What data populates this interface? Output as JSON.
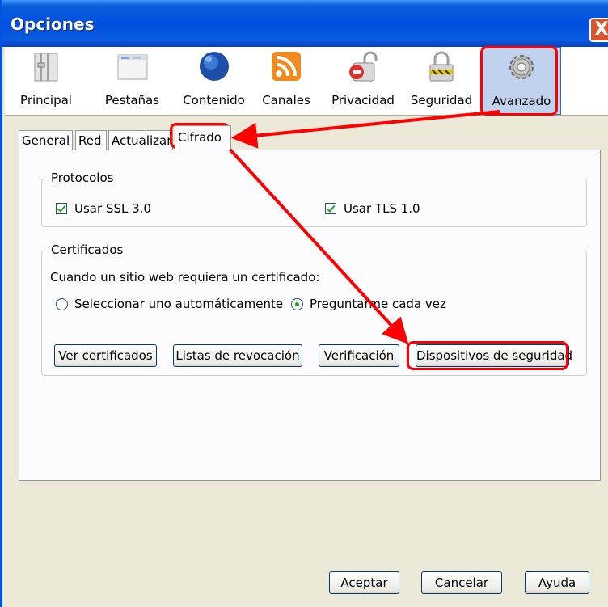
{
  "window": {
    "title": "Opciones",
    "close_label": "X"
  },
  "toolbar": {
    "items": [
      {
        "label": "Principal",
        "icon": "switch-icon"
      },
      {
        "label": "Pestañas",
        "icon": "tabs-window-icon"
      },
      {
        "label": "Contenido",
        "icon": "globe-icon"
      },
      {
        "label": "Canales",
        "icon": "rss-feed-icon"
      },
      {
        "label": "Privacidad",
        "icon": "lock-open-icon"
      },
      {
        "label": "Seguridad",
        "icon": "padlock-icon"
      },
      {
        "label": "Avanzado",
        "icon": "gear-icon",
        "active": true
      }
    ]
  },
  "tabs": [
    "General",
    "Red",
    "Actualizar",
    "Cifrado"
  ],
  "selected_tab": "Cifrado",
  "protocols": {
    "legend": "Protocolos",
    "ssl_label": "Usar SSL 3.0",
    "ssl_checked": true,
    "tls_label": "Usar TLS 1.0",
    "tls_checked": true
  },
  "certificates": {
    "legend": "Certificados",
    "prompt": "Cuando un sitio web requiera un certificado:",
    "option_auto": "Seleccionar uno automáticamente",
    "option_ask": "Preguntarme cada vez",
    "selected_option": "Preguntarme cada vez",
    "buttons": {
      "view": "Ver certificados",
      "revocation": "Listas de revocación",
      "verification": "Verificación",
      "devices": "Dispositivos de seguridad"
    }
  },
  "footer": {
    "accept": "Aceptar",
    "cancel": "Cancelar",
    "help": "Ayuda"
  },
  "colors": {
    "annotation_red": "#ff0000",
    "title_blue": "#0050e0",
    "dialog_bg": "#ece9d8",
    "check_green": "#21a121"
  }
}
